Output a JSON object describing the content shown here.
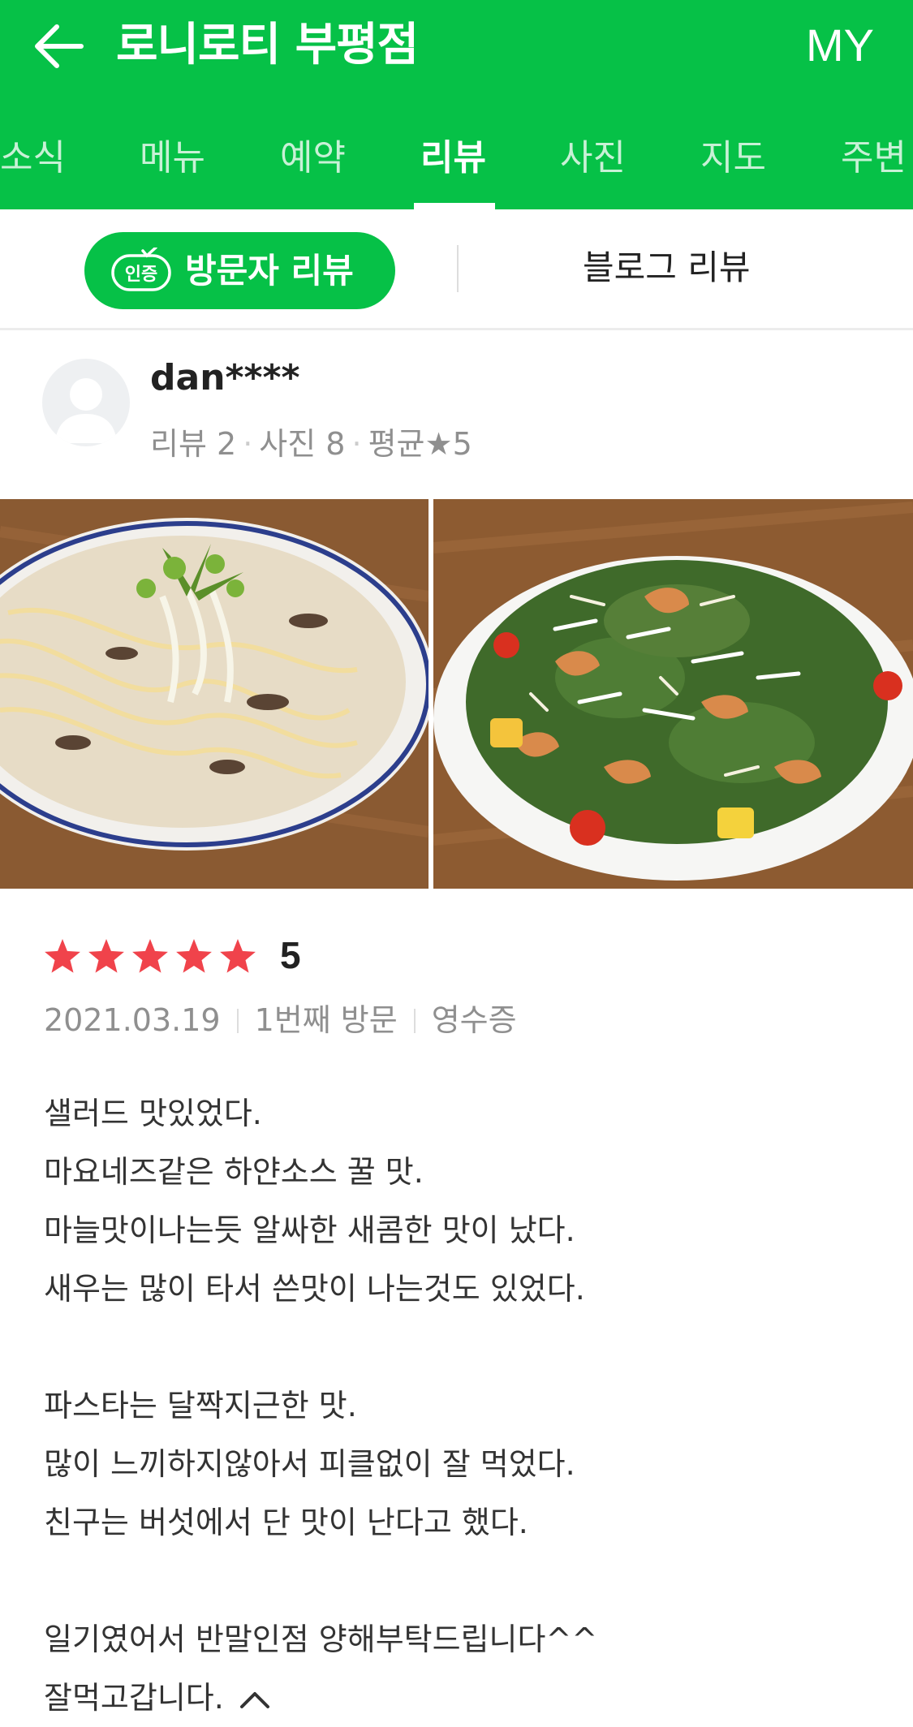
{
  "header": {
    "title": "로니로티 부평점",
    "my_label": "MY",
    "background_color": "#06c147",
    "back_icon": "arrow-left-icon"
  },
  "tabs": [
    {
      "label": "소식",
      "active": false
    },
    {
      "label": "메뉴",
      "active": false
    },
    {
      "label": "예약",
      "active": false
    },
    {
      "label": "리뷰",
      "active": true
    },
    {
      "label": "사진",
      "active": false
    },
    {
      "label": "지도",
      "active": false
    },
    {
      "label": "주변",
      "active": false
    }
  ],
  "review_type_tabs": {
    "visitor_label": "방문자 리뷰",
    "visitor_badge": "인증",
    "blog_label": "블로그 리뷰",
    "active": "visitor"
  },
  "review": {
    "author": {
      "name": "dan****",
      "review_count_label": "리뷰 2",
      "photo_count_label": "사진 8",
      "average_label": "평균",
      "average_value": "5",
      "avatar_icon": "user-placeholder-icon"
    },
    "photos": [
      {
        "icon": "cream-pasta-photo"
      },
      {
        "icon": "shrimp-salad-photo"
      }
    ],
    "rating": {
      "stars": 5,
      "max_stars": 5,
      "value": "5",
      "star_color": "#f0434b"
    },
    "date": "2021.03.19",
    "visit_label": "1번째 방문",
    "receipt_label": "영수증",
    "body_lines": [
      "샐러드 맛있었다.",
      "마요네즈같은 하얀소스 꿀 맛.",
      "마늘맛이나는듯 알싸한 새콤한 맛이 났다.",
      "새우는 많이 타서 쓴맛이 나는것도 있었다.",
      "",
      "파스타는 달짝지근한 맛.",
      "많이 느끼하지않아서 피클없이 잘 먹었다.",
      "친구는 버섯에서 단 맛이 난다고 했다.",
      "",
      "일기였어서 반말인점 양해부탁드립니다^^",
      "잘먹고갑니다."
    ],
    "collapse_icon": "chevron-up-icon"
  }
}
